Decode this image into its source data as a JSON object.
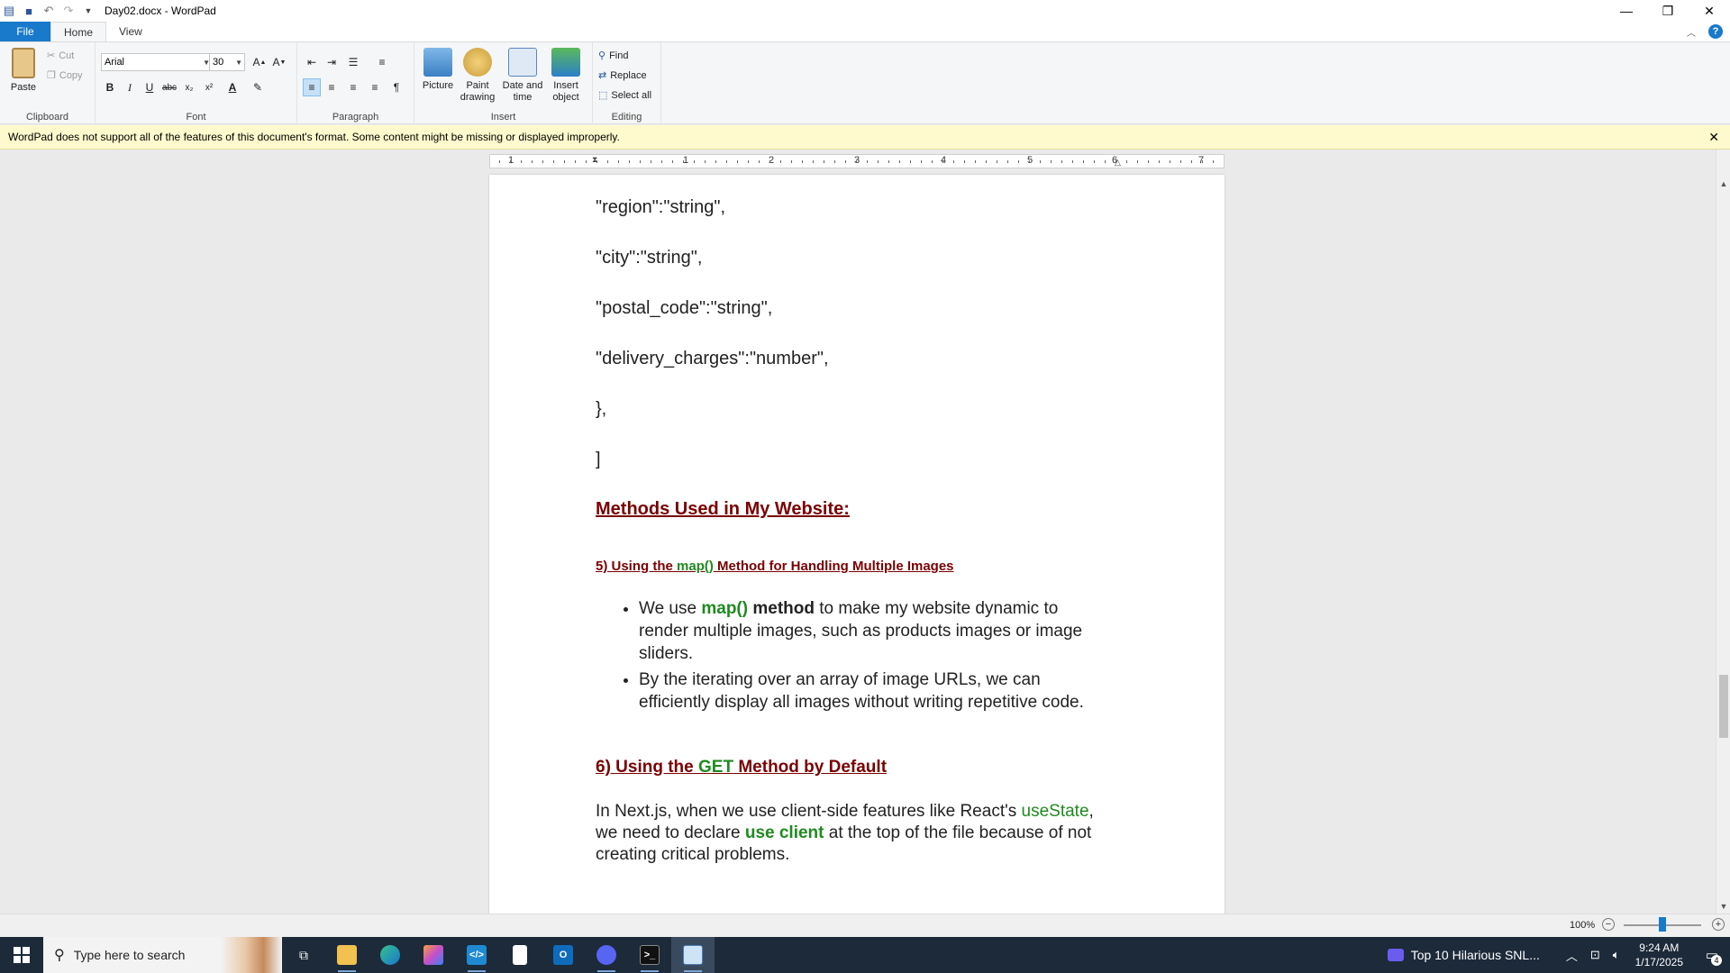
{
  "window": {
    "title": "Day02.docx - WordPad",
    "minimize": "—",
    "restore": "❐",
    "close": "✕"
  },
  "tabs": [
    {
      "label": "File"
    },
    {
      "label": "Home"
    },
    {
      "label": "View"
    }
  ],
  "ribbon": {
    "clipboard": {
      "label": "Clipboard",
      "paste": "Paste",
      "cut": "Cut",
      "copy": "Copy"
    },
    "font": {
      "label": "Font",
      "family": "Arial",
      "size": "30"
    },
    "paragraph": {
      "label": "Paragraph"
    },
    "insert": {
      "label": "Insert",
      "picture": "Picture",
      "paint_line1": "Paint",
      "paint_line2": "drawing",
      "date_line1": "Date and",
      "date_line2": "time",
      "object_line1": "Insert",
      "object_line2": "object"
    },
    "editing": {
      "label": "Editing",
      "find": "Find",
      "replace": "Replace",
      "select_all": "Select all"
    }
  },
  "warning": {
    "text": "WordPad does not support all of the features of this document's format. Some content might be missing or displayed improperly."
  },
  "ruler": {
    "numbers": [
      "1",
      "1",
      "2",
      "3",
      "4",
      "5",
      "6",
      "7"
    ]
  },
  "document": {
    "code_lines": [
      "\"region\":\"string\",",
      "\"city\":\"string\",",
      "\"postal_code\":\"string\",",
      "\"delivery_charges\":\"number\",",
      "},",
      "]"
    ],
    "heading_methods": "Methods Used in My Website:",
    "sub5_prefix": "5) Using the ",
    "sub5_green": "map()",
    "sub5_suffix": " Method for Handling Multiple Images",
    "bullet1_pre": "We use  ",
    "bullet1_green": "map()",
    "bullet1_bold": " method",
    "bullet1_post": "  to make my website  dynamic to  render multiple images, such as products images or image sliders.",
    "bullet2": "By the  iterating over an array of image URLs, we can efficiently display all images without writing repetitive code.",
    "sub6_prefix": "6) Using the ",
    "sub6_green": "GET",
    "sub6_suffix": " Method by Default",
    "para_pre": "In Next.js, when we  use client-side features like React's ",
    "para_green1": "useState",
    "para_mid": ", we need to declare ",
    "para_green2": "use client",
    "para_post": " at the top of the file because of not creating critical problems."
  },
  "statusbar": {
    "zoom": "100%",
    "zoom_level_percent": 100
  },
  "taskbar": {
    "search_placeholder": "Type here to search",
    "news_text": "Top 10 Hilarious SNL...",
    "time": "9:24 AM",
    "date": "1/17/2025",
    "notification_count": "4"
  },
  "colors": {
    "accent": "#1979ca",
    "heading": "#7a0000",
    "green": "#1f8a1f",
    "warning_bg": "#fffacd"
  }
}
